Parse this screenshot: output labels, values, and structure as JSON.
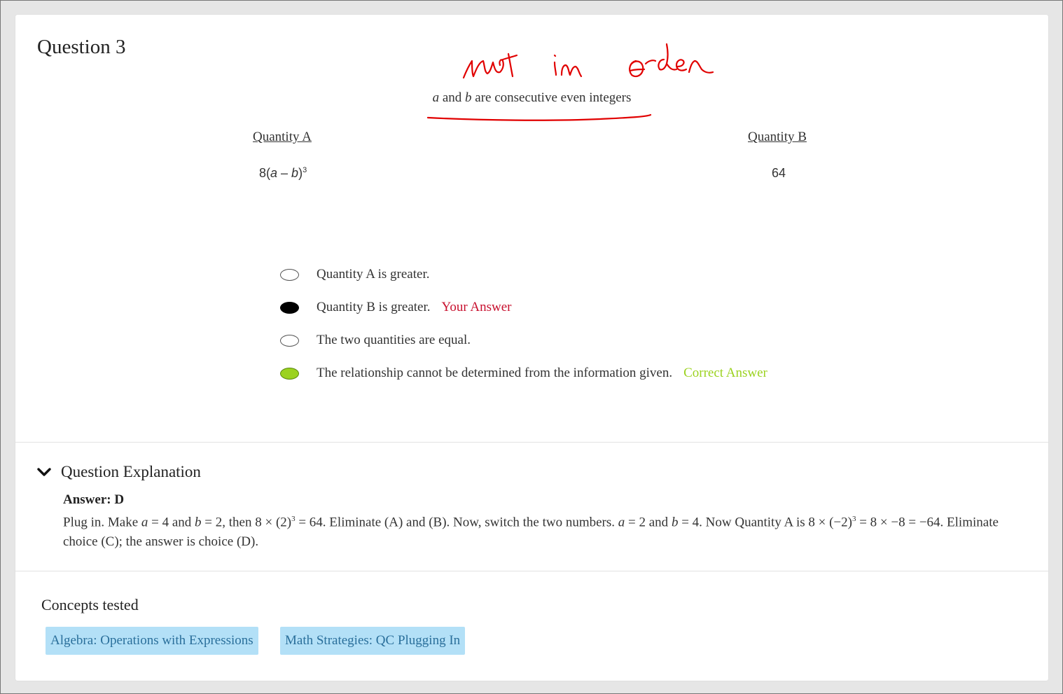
{
  "question": {
    "title": "Question 3",
    "annotation": "not in order",
    "stem": {
      "var_a": "a",
      "and_text": " and ",
      "var_b": "b",
      "rest": " are consecutive even integers"
    },
    "quantity_a": {
      "heading": "Quantity A",
      "expr_prefix": "8(",
      "var_a": "a",
      "minus": " – ",
      "var_b": "b",
      "expr_suffix": ")",
      "exponent": "3"
    },
    "quantity_b": {
      "heading": "Quantity B",
      "value": "64"
    }
  },
  "choices": [
    {
      "label": "Quantity A is greater.",
      "state": "empty",
      "tag": ""
    },
    {
      "label": "Quantity B is greater.",
      "state": "selected",
      "tag": "Your Answer"
    },
    {
      "label": "The two quantities are equal.",
      "state": "empty",
      "tag": ""
    },
    {
      "label": "The relationship cannot be determined from the information given.",
      "state": "correct",
      "tag": "Correct Answer"
    }
  ],
  "colors": {
    "your_answer": "#c8102e",
    "correct_answer": "#9bd21f",
    "ink": "#e10000",
    "chip_bg": "#b3e0f7",
    "chip_text": "#2a6f9b"
  },
  "explanation": {
    "header": "Question Explanation",
    "answer_label": "Answer: D",
    "t1": "Plug in. Make ",
    "a1": "a",
    "t2": " = 4 and ",
    "b1": "b",
    "t3": " = 2, then 8 × (2)",
    "e1": "3",
    "t4": " = 64. Eliminate (A) and (B). Now, switch the two numbers. ",
    "a2": "a",
    "t5": " = 2 and ",
    "b2": "b",
    "t6": " = 4. Now Quantity A is 8 × (−2)",
    "e2": "3",
    "t7": " = 8 × −8 = −64. Eliminate choice (C); the answer is choice (D)."
  },
  "concepts": {
    "title": "Concepts tested",
    "tags": [
      "Algebra: Operations with Expressions",
      "Math Strategies: QC Plugging In"
    ]
  }
}
